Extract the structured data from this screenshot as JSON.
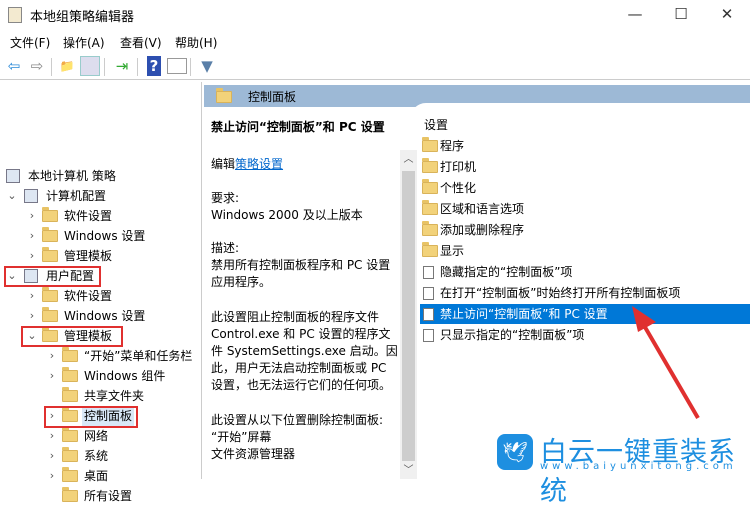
{
  "window": {
    "title": "本地组策略编辑器",
    "min": "—",
    "max": "☐",
    "close": "✕"
  },
  "menu": [
    "文件(F)",
    "操作(A)",
    "查看(V)",
    "帮助(H)"
  ],
  "toolbar": {
    "back": "⇦",
    "forward": "⇨",
    "up": "📁",
    "help": "?",
    "filter": "▼"
  },
  "tree": [
    {
      "label": "本地计算机 策略"
    },
    {
      "label": "计算机配置"
    },
    {
      "label": "软件设置"
    },
    {
      "label": "Windows 设置"
    },
    {
      "label": "管理模板"
    },
    {
      "label": "用户配置"
    },
    {
      "label": "软件设置"
    },
    {
      "label": "Windows 设置"
    },
    {
      "label": "管理模板"
    },
    {
      "label": "“开始”菜单和任务栏"
    },
    {
      "label": "Windows 组件"
    },
    {
      "label": "共享文件夹"
    },
    {
      "label": "控制面板"
    },
    {
      "label": "网络"
    },
    {
      "label": "系统"
    },
    {
      "label": "桌面"
    },
    {
      "label": "所有设置"
    }
  ],
  "header": {
    "title": "控制面板"
  },
  "detail": {
    "title": "禁止访问“控制面板”和 PC 设置",
    "edit_prefix": "编辑",
    "edit_link": "策略设置",
    "req_label": "要求:",
    "req_value": "Windows 2000 及以上版本",
    "desc_label": "描述:",
    "desc": [
      "禁用所有控制面板程序和 PC 设置",
      "应用程序。",
      "",
      "此设置阻止控制面板的程序文件",
      "Control.exe 和 PC 设置的程序文",
      "件 SystemSettings.exe 启动。因",
      "此，用户无法启动控制面板或 PC",
      "设置，也无法运行它们的任何项。",
      "",
      "此设置从以下位置删除控制面板:",
      "“开始”屏幕",
      "文件资源管理器"
    ]
  },
  "list": {
    "header": "设置",
    "items": [
      {
        "label": "程序",
        "type": "folder"
      },
      {
        "label": "打印机",
        "type": "folder"
      },
      {
        "label": "个性化",
        "type": "folder"
      },
      {
        "label": "区域和语言选项",
        "type": "folder"
      },
      {
        "label": "添加或删除程序",
        "type": "folder"
      },
      {
        "label": "显示",
        "type": "folder"
      },
      {
        "label": "隐藏指定的“控制面板”项",
        "type": "policy"
      },
      {
        "label": "在打开“控制面板”时始终打开所有控制面板项",
        "type": "policy"
      },
      {
        "label": "禁止访问“控制面板”和 PC 设置",
        "type": "policy",
        "selected": true
      },
      {
        "label": "只显示指定的“控制面板”项",
        "type": "policy"
      }
    ]
  },
  "watermark": {
    "name": "白云一键重装系统",
    "url": "www.baiyunxitong.com"
  },
  "colors": {
    "selection": "#0078d7",
    "header": "#9db9d6",
    "annotation": "#e0302f"
  }
}
